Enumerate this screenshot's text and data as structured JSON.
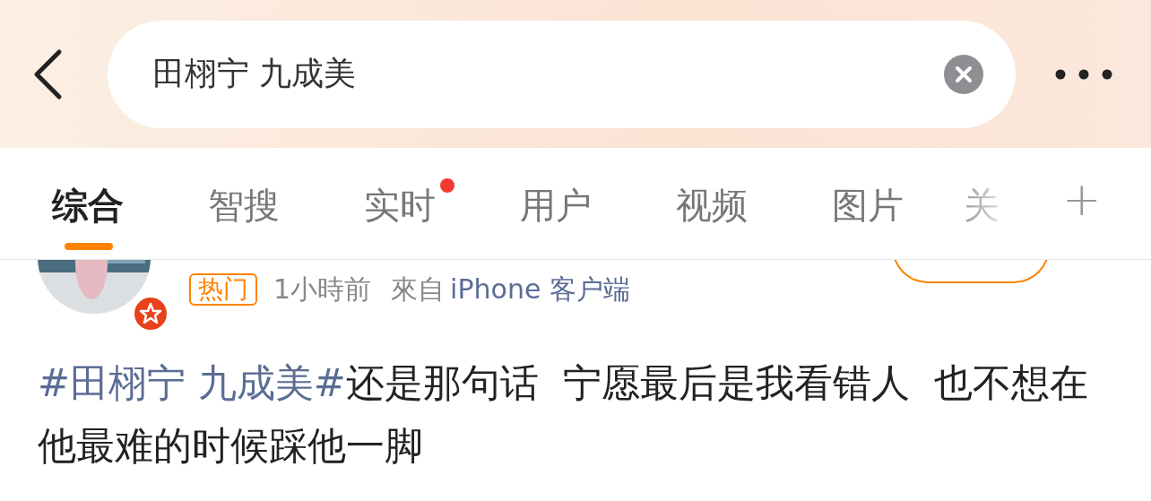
{
  "search": {
    "value": "田栩宁 九成美"
  },
  "tabs": [
    {
      "label": "综合",
      "selected": true,
      "dot": false
    },
    {
      "label": "智搜",
      "selected": false,
      "dot": false
    },
    {
      "label": "实时",
      "selected": false,
      "dot": true
    },
    {
      "label": "用户",
      "selected": false,
      "dot": false
    },
    {
      "label": "视频",
      "selected": false,
      "dot": false
    },
    {
      "label": "图片",
      "selected": false,
      "dot": false
    },
    {
      "label": "关",
      "selected": false,
      "dot": false
    }
  ],
  "add_tab": "+",
  "post": {
    "tag": "热门",
    "time": "1小時前",
    "source_prefix": "來自",
    "source": "iPhone 客户端",
    "text": [
      {
        "kind": "hashtag",
        "text": "#田栩宁 九成美#"
      },
      {
        "kind": "plain",
        "text": "还是那句话  宁愿最后是我看错人  也不想在他最难的时候踩他一脚"
      }
    ]
  }
}
